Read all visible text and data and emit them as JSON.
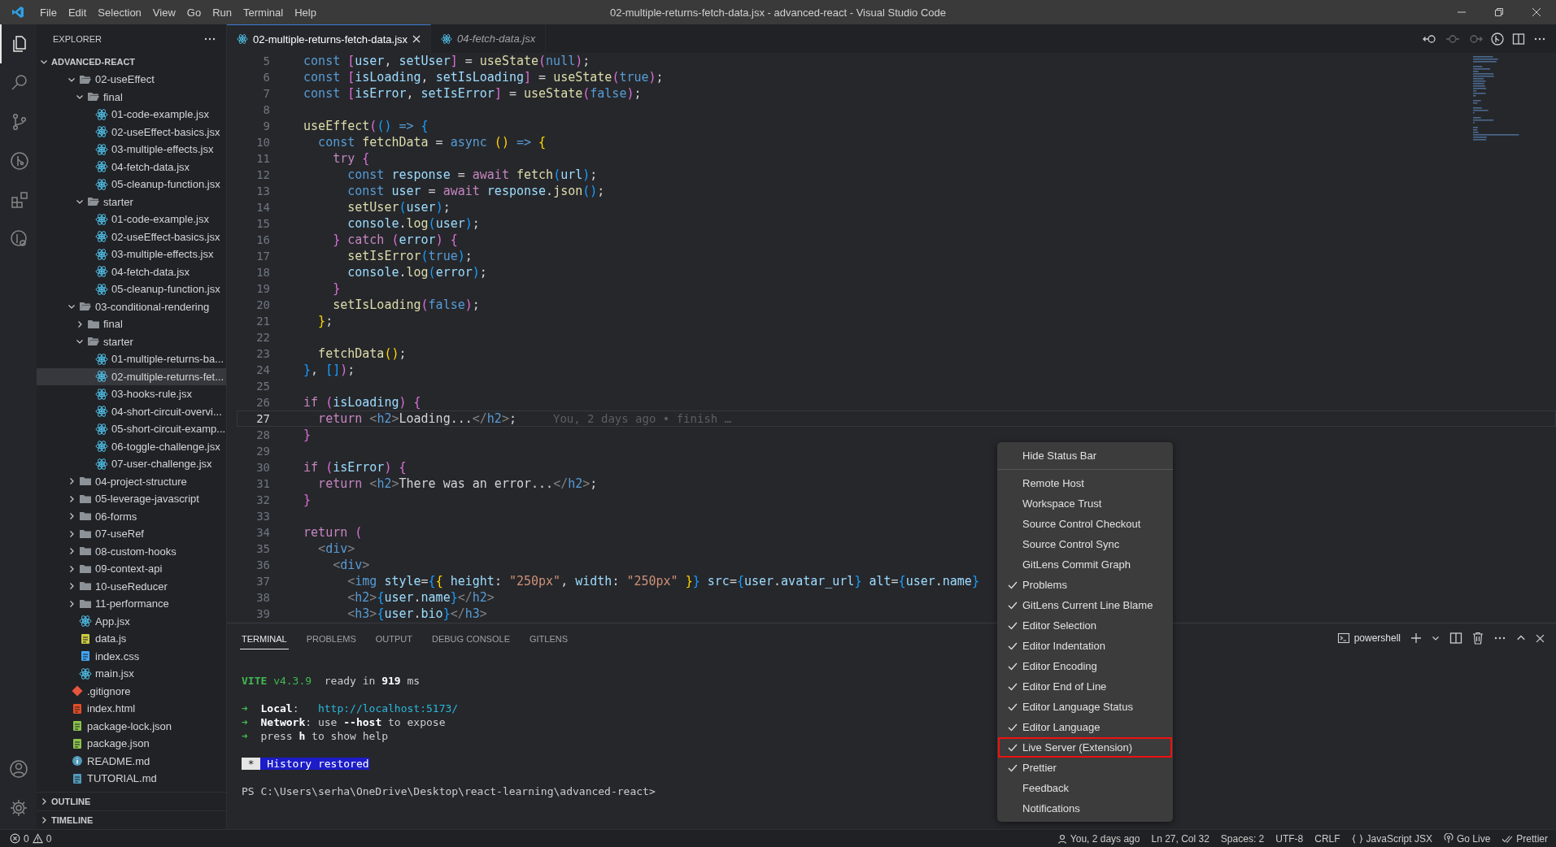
{
  "title_bar": {
    "menus": [
      "File",
      "Edit",
      "Selection",
      "View",
      "Go",
      "Run",
      "Terminal",
      "Help"
    ],
    "title": "02-multiple-returns-fetch-data.jsx - advanced-react - Visual Studio Code"
  },
  "activity_bar": [
    {
      "kind": "files",
      "selected": true
    },
    {
      "kind": "search",
      "selected": false
    },
    {
      "kind": "scm",
      "selected": false
    },
    {
      "kind": "gitlens",
      "selected": false
    },
    {
      "kind": "extensions",
      "selected": false
    },
    {
      "kind": "inspect",
      "selected": false
    }
  ],
  "explorer": {
    "title": "EXPLORER",
    "root": {
      "label": "ADVANCED-REACT",
      "expanded": true
    },
    "tree": [
      {
        "label": "02-useEffect",
        "kind": "folder",
        "expanded": true,
        "selected": false,
        "children": [
          {
            "label": "final",
            "kind": "folder",
            "expanded": true,
            "selected": false,
            "children": [
              {
                "label": "01-code-example.jsx",
                "kind": "react",
                "selected": false
              },
              {
                "label": "02-useEffect-basics.jsx",
                "kind": "react",
                "selected": false
              },
              {
                "label": "03-multiple-effects.jsx",
                "kind": "react",
                "selected": false
              },
              {
                "label": "04-fetch-data.jsx",
                "kind": "react",
                "selected": false
              },
              {
                "label": "05-cleanup-function.jsx",
                "kind": "react",
                "selected": false
              }
            ]
          },
          {
            "label": "starter",
            "kind": "folder",
            "expanded": true,
            "selected": false,
            "children": [
              {
                "label": "01-code-example.jsx",
                "kind": "react",
                "selected": false
              },
              {
                "label": "02-useEffect-basics.jsx",
                "kind": "react",
                "selected": false
              },
              {
                "label": "03-multiple-effects.jsx",
                "kind": "react",
                "selected": false
              },
              {
                "label": "04-fetch-data.jsx",
                "kind": "react",
                "selected": false
              },
              {
                "label": "05-cleanup-function.jsx",
                "kind": "react",
                "selected": false
              }
            ]
          }
        ]
      },
      {
        "label": "03-conditional-rendering",
        "kind": "folder",
        "expanded": true,
        "selected": false,
        "children": [
          {
            "label": "final",
            "kind": "folder",
            "expanded": false,
            "selected": false
          },
          {
            "label": "starter",
            "kind": "folder",
            "expanded": true,
            "selected": false,
            "children": [
              {
                "label": "01-multiple-returns-ba...",
                "kind": "react",
                "selected": false
              },
              {
                "label": "02-multiple-returns-fet...",
                "kind": "react",
                "selected": true
              },
              {
                "label": "03-hooks-rule.jsx",
                "kind": "react",
                "selected": false
              },
              {
                "label": "04-short-circuit-overvi...",
                "kind": "react",
                "selected": false
              },
              {
                "label": "05-short-circuit-examp...",
                "kind": "react",
                "selected": false
              },
              {
                "label": "06-toggle-challenge.jsx",
                "kind": "react",
                "selected": false
              },
              {
                "label": "07-user-challenge.jsx",
                "kind": "react",
                "selected": false
              }
            ]
          }
        ]
      },
      {
        "label": "04-project-structure",
        "kind": "folder",
        "expanded": false,
        "selected": false
      },
      {
        "label": "05-leverage-javascript",
        "kind": "folder",
        "expanded": false,
        "selected": false
      },
      {
        "label": "06-forms",
        "kind": "folder",
        "expanded": false,
        "selected": false
      },
      {
        "label": "07-useRef",
        "kind": "folder",
        "expanded": false,
        "selected": false
      },
      {
        "label": "08-custom-hooks",
        "kind": "folder",
        "expanded": false,
        "selected": false
      },
      {
        "label": "09-context-api",
        "kind": "folder",
        "expanded": false,
        "selected": false
      },
      {
        "label": "10-useReducer",
        "kind": "folder",
        "expanded": false,
        "selected": false
      },
      {
        "label": "11-performance",
        "kind": "folder",
        "expanded": false,
        "selected": false
      },
      {
        "label": "App.jsx",
        "kind": "react",
        "selected": false
      },
      {
        "label": "data.js",
        "kind": "js",
        "selected": false
      },
      {
        "label": "index.css",
        "kind": "css",
        "selected": false
      },
      {
        "label": "main.jsx",
        "kind": "react",
        "selected": false
      }
    ],
    "root_files": [
      {
        "label": ".gitignore",
        "kind": "git",
        "selected": false
      },
      {
        "label": "index.html",
        "kind": "html",
        "selected": false
      },
      {
        "label": "package-lock.json",
        "kind": "json",
        "selected": false
      },
      {
        "label": "package.json",
        "kind": "json",
        "selected": false
      },
      {
        "label": "README.md",
        "kind": "info",
        "selected": false
      },
      {
        "label": "TUTORIAL.md",
        "kind": "markdown",
        "selected": false
      }
    ],
    "sections": [
      {
        "label": "OUTLINE",
        "expanded": false
      },
      {
        "label": "TIMELINE",
        "expanded": false
      }
    ]
  },
  "editor": {
    "tabs": [
      {
        "label": "02-multiple-returns-fetch-data.jsx",
        "selected": true,
        "preview": false
      },
      {
        "label": "04-fetch-data.jsx",
        "selected": false,
        "preview": true
      }
    ],
    "lines": [
      {
        "number": "5",
        "current": false,
        "tokens": [
          {
            "text": "  const",
            "kind": "kw"
          },
          {
            "text": " [",
            "kind": "b2"
          },
          {
            "text": "user",
            "kind": "var"
          },
          {
            "text": ", ",
            "kind": "pl"
          },
          {
            "text": "setUser",
            "kind": "var"
          },
          {
            "text": "]",
            "kind": "b2"
          },
          {
            "text": " = ",
            "kind": "pl"
          },
          {
            "text": "useState",
            "kind": "fn"
          },
          {
            "text": "(",
            "kind": "b2"
          },
          {
            "text": "null",
            "kind": "kw"
          },
          {
            "text": ")",
            "kind": "b2"
          },
          {
            "text": ";",
            "kind": "pl"
          }
        ]
      },
      {
        "number": "6",
        "current": false,
        "tokens": [
          {
            "text": "  const",
            "kind": "kw"
          },
          {
            "text": " [",
            "kind": "b2"
          },
          {
            "text": "isLoading",
            "kind": "var"
          },
          {
            "text": ", ",
            "kind": "pl"
          },
          {
            "text": "setIsLoading",
            "kind": "var"
          },
          {
            "text": "]",
            "kind": "b2"
          },
          {
            "text": " = ",
            "kind": "pl"
          },
          {
            "text": "useState",
            "kind": "fn"
          },
          {
            "text": "(",
            "kind": "b2"
          },
          {
            "text": "true",
            "kind": "kw"
          },
          {
            "text": ")",
            "kind": "b2"
          },
          {
            "text": ";",
            "kind": "pl"
          }
        ]
      },
      {
        "number": "7",
        "current": false,
        "tokens": [
          {
            "text": "  const",
            "kind": "kw"
          },
          {
            "text": " [",
            "kind": "b2"
          },
          {
            "text": "isError",
            "kind": "var"
          },
          {
            "text": ", ",
            "kind": "pl"
          },
          {
            "text": "setIsError",
            "kind": "var"
          },
          {
            "text": "]",
            "kind": "b2"
          },
          {
            "text": " = ",
            "kind": "pl"
          },
          {
            "text": "useState",
            "kind": "fn"
          },
          {
            "text": "(",
            "kind": "b2"
          },
          {
            "text": "false",
            "kind": "kw"
          },
          {
            "text": ")",
            "kind": "b2"
          },
          {
            "text": ";",
            "kind": "pl"
          }
        ]
      },
      {
        "number": "8",
        "current": false
      },
      {
        "number": "9",
        "current": false,
        "tokens": [
          {
            "text": "  useEffect",
            "kind": "fn"
          },
          {
            "text": "(",
            "kind": "b2"
          },
          {
            "text": "()",
            "kind": "b3"
          },
          {
            "text": " =>",
            "kind": "kw"
          },
          {
            "text": " {",
            "kind": "b3"
          }
        ]
      },
      {
        "number": "10",
        "current": false,
        "tokens": [
          {
            "text": "    const",
            "kind": "kw"
          },
          {
            "text": " fetchData",
            "kind": "fn"
          },
          {
            "text": " = ",
            "kind": "pl"
          },
          {
            "text": "async",
            "kind": "kw"
          },
          {
            "text": " ()",
            "kind": "b1"
          },
          {
            "text": " =>",
            "kind": "kw"
          },
          {
            "text": " {",
            "kind": "b1"
          }
        ]
      },
      {
        "number": "11",
        "current": false,
        "tokens": [
          {
            "text": "      try",
            "kind": "ctl"
          },
          {
            "text": " {",
            "kind": "b2"
          }
        ]
      },
      {
        "number": "12",
        "current": false,
        "tokens": [
          {
            "text": "        const",
            "kind": "kw"
          },
          {
            "text": " response",
            "kind": "var"
          },
          {
            "text": " = ",
            "kind": "pl"
          },
          {
            "text": "await",
            "kind": "ctl"
          },
          {
            "text": " fetch",
            "kind": "fn"
          },
          {
            "text": "(",
            "kind": "b3"
          },
          {
            "text": "url",
            "kind": "var"
          },
          {
            "text": ")",
            "kind": "b3"
          },
          {
            "text": ";",
            "kind": "pl"
          }
        ]
      },
      {
        "number": "13",
        "current": false,
        "tokens": [
          {
            "text": "        const",
            "kind": "kw"
          },
          {
            "text": " user",
            "kind": "var"
          },
          {
            "text": " = ",
            "kind": "pl"
          },
          {
            "text": "await",
            "kind": "ctl"
          },
          {
            "text": " response",
            "kind": "var"
          },
          {
            "text": ".",
            "kind": "pl"
          },
          {
            "text": "json",
            "kind": "fn"
          },
          {
            "text": "()",
            "kind": "b3"
          },
          {
            "text": ";",
            "kind": "pl"
          }
        ]
      },
      {
        "number": "14",
        "current": false,
        "tokens": [
          {
            "text": "        setUser",
            "kind": "fn"
          },
          {
            "text": "(",
            "kind": "b3"
          },
          {
            "text": "user",
            "kind": "var"
          },
          {
            "text": ")",
            "kind": "b3"
          },
          {
            "text": ";",
            "kind": "pl"
          }
        ]
      },
      {
        "number": "15",
        "current": false,
        "tokens": [
          {
            "text": "        console",
            "kind": "var"
          },
          {
            "text": ".",
            "kind": "pl"
          },
          {
            "text": "log",
            "kind": "fn"
          },
          {
            "text": "(",
            "kind": "b3"
          },
          {
            "text": "user",
            "kind": "var"
          },
          {
            "text": ")",
            "kind": "b3"
          },
          {
            "text": ";",
            "kind": "pl"
          }
        ]
      },
      {
        "number": "16",
        "current": false,
        "tokens": [
          {
            "text": "      }",
            "kind": "b2"
          },
          {
            "text": " catch",
            "kind": "ctl"
          },
          {
            "text": " (",
            "kind": "b2"
          },
          {
            "text": "error",
            "kind": "var"
          },
          {
            "text": ")",
            "kind": "b2"
          },
          {
            "text": " {",
            "kind": "b2"
          }
        ]
      },
      {
        "number": "17",
        "current": false,
        "tokens": [
          {
            "text": "        setIsError",
            "kind": "fn"
          },
          {
            "text": "(",
            "kind": "b3"
          },
          {
            "text": "true",
            "kind": "kw"
          },
          {
            "text": ")",
            "kind": "b3"
          },
          {
            "text": ";",
            "kind": "pl"
          }
        ]
      },
      {
        "number": "18",
        "current": false,
        "tokens": [
          {
            "text": "        console",
            "kind": "var"
          },
          {
            "text": ".",
            "kind": "pl"
          },
          {
            "text": "log",
            "kind": "fn"
          },
          {
            "text": "(",
            "kind": "b3"
          },
          {
            "text": "error",
            "kind": "var"
          },
          {
            "text": ")",
            "kind": "b3"
          },
          {
            "text": ";",
            "kind": "pl"
          }
        ]
      },
      {
        "number": "19",
        "current": false,
        "tokens": [
          {
            "text": "      }",
            "kind": "b2"
          }
        ]
      },
      {
        "number": "20",
        "current": false,
        "tokens": [
          {
            "text": "      setIsLoading",
            "kind": "fn"
          },
          {
            "text": "(",
            "kind": "b2"
          },
          {
            "text": "false",
            "kind": "kw"
          },
          {
            "text": ")",
            "kind": "b2"
          },
          {
            "text": ";",
            "kind": "pl"
          }
        ]
      },
      {
        "number": "21",
        "current": false,
        "tokens": [
          {
            "text": "    }",
            "kind": "b1"
          },
          {
            "text": ";",
            "kind": "pl"
          }
        ]
      },
      {
        "number": "22",
        "current": false
      },
      {
        "number": "23",
        "current": false,
        "tokens": [
          {
            "text": "    fetchData",
            "kind": "fn"
          },
          {
            "text": "()",
            "kind": "b1"
          },
          {
            "text": ";",
            "kind": "pl"
          }
        ]
      },
      {
        "number": "24",
        "current": false,
        "tokens": [
          {
            "text": "  }",
            "kind": "b3"
          },
          {
            "text": ", ",
            "kind": "pl"
          },
          {
            "text": "[]",
            "kind": "b3"
          },
          {
            "text": ")",
            "kind": "b2"
          },
          {
            "text": ";",
            "kind": "pl"
          }
        ]
      },
      {
        "number": "25",
        "current": false
      },
      {
        "number": "26",
        "current": false,
        "tokens": [
          {
            "text": "  if",
            "kind": "ctl"
          },
          {
            "text": " (",
            "kind": "b2"
          },
          {
            "text": "isLoading",
            "kind": "var"
          },
          {
            "text": ")",
            "kind": "b2"
          },
          {
            "text": " {",
            "kind": "b2"
          }
        ]
      },
      {
        "number": "27",
        "current": true,
        "blame": "You, 2 days ago • finish …",
        "tokens": [
          {
            "text": "    return",
            "kind": "ctl"
          },
          {
            "text": " <",
            "kind": "pun"
          },
          {
            "text": "h2",
            "kind": "tag"
          },
          {
            "text": ">",
            "kind": "pun"
          },
          {
            "text": "Loading...",
            "kind": "pl"
          },
          {
            "text": "</",
            "kind": "pun"
          },
          {
            "text": "h2",
            "kind": "tag"
          },
          {
            "text": ">",
            "kind": "pun"
          },
          {
            "text": ";",
            "kind": "pl"
          }
        ]
      },
      {
        "number": "28",
        "current": false,
        "tokens": [
          {
            "text": "  }",
            "kind": "b2"
          }
        ]
      },
      {
        "number": "29",
        "current": false
      },
      {
        "number": "30",
        "current": false,
        "tokens": [
          {
            "text": "  if",
            "kind": "ctl"
          },
          {
            "text": " (",
            "kind": "b2"
          },
          {
            "text": "isError",
            "kind": "var"
          },
          {
            "text": ")",
            "kind": "b2"
          },
          {
            "text": " {",
            "kind": "b2"
          }
        ]
      },
      {
        "number": "31",
        "current": false,
        "tokens": [
          {
            "text": "    return",
            "kind": "ctl"
          },
          {
            "text": " <",
            "kind": "pun"
          },
          {
            "text": "h2",
            "kind": "tag"
          },
          {
            "text": ">",
            "kind": "pun"
          },
          {
            "text": "There was an error...",
            "kind": "pl"
          },
          {
            "text": "</",
            "kind": "pun"
          },
          {
            "text": "h2",
            "kind": "tag"
          },
          {
            "text": ">",
            "kind": "pun"
          },
          {
            "text": ";",
            "kind": "pl"
          }
        ]
      },
      {
        "number": "32",
        "current": false,
        "tokens": [
          {
            "text": "  }",
            "kind": "b2"
          }
        ]
      },
      {
        "number": "33",
        "current": false
      },
      {
        "number": "34",
        "current": false,
        "tokens": [
          {
            "text": "  return",
            "kind": "ctl"
          },
          {
            "text": " (",
            "kind": "b2"
          }
        ]
      },
      {
        "number": "35",
        "current": false,
        "tokens": [
          {
            "text": "    <",
            "kind": "pun"
          },
          {
            "text": "div",
            "kind": "tag"
          },
          {
            "text": ">",
            "kind": "pun"
          }
        ]
      },
      {
        "number": "36",
        "current": false,
        "tokens": [
          {
            "text": "      <",
            "kind": "pun"
          },
          {
            "text": "div",
            "kind": "tag"
          },
          {
            "text": ">",
            "kind": "pun"
          }
        ]
      },
      {
        "number": "37",
        "current": false,
        "tokens": [
          {
            "text": "        <",
            "kind": "pun"
          },
          {
            "text": "img",
            "kind": "tag"
          },
          {
            "text": " style",
            "kind": "var"
          },
          {
            "text": "=",
            "kind": "pl"
          },
          {
            "text": "{",
            "kind": "b3"
          },
          {
            "text": "{",
            "kind": "b1"
          },
          {
            "text": " height",
            "kind": "var"
          },
          {
            "text": ": ",
            "kind": "pl"
          },
          {
            "text": "\"250px\"",
            "kind": "str"
          },
          {
            "text": ", ",
            "kind": "pl"
          },
          {
            "text": "width",
            "kind": "var"
          },
          {
            "text": ": ",
            "kind": "pl"
          },
          {
            "text": "\"250px\"",
            "kind": "str"
          },
          {
            "text": " }",
            "kind": "b1"
          },
          {
            "text": "}",
            "kind": "b3"
          },
          {
            "text": " src",
            "kind": "var"
          },
          {
            "text": "=",
            "kind": "pl"
          },
          {
            "text": "{",
            "kind": "b3"
          },
          {
            "text": "user",
            "kind": "var"
          },
          {
            "text": ".",
            "kind": "pl"
          },
          {
            "text": "avatar_url",
            "kind": "var"
          },
          {
            "text": "}",
            "kind": "b3"
          },
          {
            "text": " alt",
            "kind": "var"
          },
          {
            "text": "=",
            "kind": "pl"
          },
          {
            "text": "{",
            "kind": "b3"
          },
          {
            "text": "user",
            "kind": "var"
          },
          {
            "text": ".",
            "kind": "pl"
          },
          {
            "text": "name",
            "kind": "var"
          },
          {
            "text": "}",
            "kind": "b3"
          }
        ]
      },
      {
        "number": "38",
        "current": false,
        "tokens": [
          {
            "text": "        <",
            "kind": "pun"
          },
          {
            "text": "h2",
            "kind": "tag"
          },
          {
            "text": ">",
            "kind": "pun"
          },
          {
            "text": "{",
            "kind": "b3"
          },
          {
            "text": "user",
            "kind": "var"
          },
          {
            "text": ".",
            "kind": "pl"
          },
          {
            "text": "name",
            "kind": "var"
          },
          {
            "text": "}",
            "kind": "b3"
          },
          {
            "text": "</",
            "kind": "pun"
          },
          {
            "text": "h2",
            "kind": "tag"
          },
          {
            "text": ">",
            "kind": "pun"
          }
        ]
      },
      {
        "number": "39",
        "current": false,
        "tokens": [
          {
            "text": "        <",
            "kind": "pun"
          },
          {
            "text": "h3",
            "kind": "tag"
          },
          {
            "text": ">",
            "kind": "pun"
          },
          {
            "text": "{",
            "kind": "b3"
          },
          {
            "text": "user",
            "kind": "var"
          },
          {
            "text": ".",
            "kind": "pl"
          },
          {
            "text": "bio",
            "kind": "var"
          },
          {
            "text": "}",
            "kind": "b3"
          },
          {
            "text": "</",
            "kind": "pun"
          },
          {
            "text": "h3",
            "kind": "tag"
          },
          {
            "text": ">",
            "kind": "pun"
          }
        ]
      }
    ]
  },
  "panel": {
    "tabs": [
      {
        "label": "TERMINAL",
        "selected": true
      },
      {
        "label": "PROBLEMS",
        "selected": false
      },
      {
        "label": "OUTPUT",
        "selected": false
      },
      {
        "label": "DEBUG CONSOLE",
        "selected": false
      },
      {
        "label": "GITLENS",
        "selected": false
      }
    ],
    "terminal_name": "powershell",
    "blocks": [
      [
        [
          {
            "text": "VITE",
            "kind": "accent-bold"
          },
          {
            "text": " v4.3.9",
            "kind": "accent"
          },
          {
            "text": "  ready in ",
            "kind": "plain"
          },
          {
            "text": "919",
            "kind": "strong"
          },
          {
            "text": " ms",
            "kind": "plain"
          }
        ]
      ],
      [
        [
          {
            "text": "➜",
            "kind": "accent"
          },
          {
            "text": "  Local",
            "kind": "strong"
          },
          {
            "text": ":   ",
            "kind": "plain"
          },
          {
            "text": "http://localhost:5173/",
            "kind": "link"
          }
        ],
        [
          {
            "text": "➜",
            "kind": "accent"
          },
          {
            "text": "  Network",
            "kind": "strong"
          },
          {
            "text": ": use ",
            "kind": "plain"
          },
          {
            "text": "--host",
            "kind": "strong"
          },
          {
            "text": " to expose",
            "kind": "plain"
          }
        ],
        [
          {
            "text": "➜",
            "kind": "accent"
          },
          {
            "text": "  press ",
            "kind": "plain"
          },
          {
            "text": "h",
            "kind": "strong"
          },
          {
            "text": " to show help",
            "kind": "plain"
          }
        ]
      ],
      [
        [
          {
            "text": " * ",
            "kind": "marker"
          },
          {
            "text": " History restored",
            "kind": "banner"
          }
        ]
      ],
      [
        [
          {
            "text": "PS C:\\Users\\serha\\OneDrive\\Desktop\\react-learning\\advanced-react>",
            "kind": "plain"
          }
        ]
      ]
    ]
  },
  "status_bar_menu": {
    "top_item": "Hide Status Bar",
    "items": [
      {
        "label": "Remote Host",
        "checked": false,
        "highlighted": false
      },
      {
        "label": "Workspace Trust",
        "checked": false,
        "highlighted": false
      },
      {
        "label": "Source Control Checkout",
        "checked": false,
        "highlighted": false
      },
      {
        "label": "Source Control Sync",
        "checked": false,
        "highlighted": false
      },
      {
        "label": "GitLens Commit Graph",
        "checked": false,
        "highlighted": false
      },
      {
        "label": "Problems",
        "checked": true,
        "highlighted": false
      },
      {
        "label": "GitLens Current Line Blame",
        "checked": true,
        "highlighted": false
      },
      {
        "label": "Editor Selection",
        "checked": true,
        "highlighted": false
      },
      {
        "label": "Editor Indentation",
        "checked": true,
        "highlighted": false
      },
      {
        "label": "Editor Encoding",
        "checked": true,
        "highlighted": false
      },
      {
        "label": "Editor End of Line",
        "checked": true,
        "highlighted": false
      },
      {
        "label": "Editor Language Status",
        "checked": true,
        "highlighted": false
      },
      {
        "label": "Editor Language",
        "checked": true,
        "highlighted": false
      },
      {
        "label": "Live Server (Extension)",
        "checked": true,
        "highlighted": true
      },
      {
        "label": "Prettier",
        "checked": true,
        "highlighted": false
      },
      {
        "label": "Feedback",
        "checked": false,
        "highlighted": false
      },
      {
        "label": "Notifications",
        "checked": false,
        "highlighted": false
      }
    ]
  },
  "status_bar": {
    "errors": "0",
    "warnings": "0",
    "items": [
      {
        "kind": "person",
        "label": "You, 2 days ago"
      },
      {
        "kind": "plain",
        "label": "Ln 27, Col 32"
      },
      {
        "kind": "plain",
        "label": "Spaces: 2"
      },
      {
        "kind": "plain",
        "label": "UTF-8"
      },
      {
        "kind": "plain",
        "label": "CRLF"
      },
      {
        "kind": "braces",
        "label": "JavaScript JSX"
      },
      {
        "kind": "broadcast",
        "label": "Go Live"
      },
      {
        "kind": "checks",
        "label": "Prettier"
      }
    ]
  }
}
